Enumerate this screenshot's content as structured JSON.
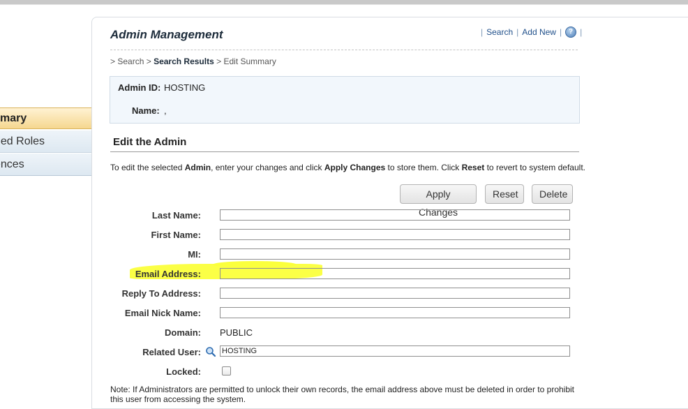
{
  "nav": {
    "items": [
      {
        "label": "mary",
        "active": true
      },
      {
        "label": "ned Roles",
        "active": false
      },
      {
        "label": "ences",
        "active": false
      }
    ]
  },
  "header": {
    "title": "Admin Management",
    "links": {
      "search": "Search",
      "add_new": "Add New",
      "help_glyph": "?"
    }
  },
  "breadcrumb": {
    "prefix": "> ",
    "item1": "Search",
    "sep": " > ",
    "item2": "Search Results",
    "item3": "Edit Summary"
  },
  "summary": {
    "admin_id_label": "Admin ID:",
    "admin_id_value": "HOSTING",
    "name_label": "Name:",
    "name_value": ","
  },
  "section": {
    "title": "Edit the Admin",
    "instr_1": "To edit the selected ",
    "instr_2": "Admin",
    "instr_3": ", enter your changes and click ",
    "instr_4": "Apply Changes",
    "instr_5": " to store them. Click ",
    "instr_6": "Reset",
    "instr_7": " to revert to system default."
  },
  "buttons": {
    "apply": "Apply Changes",
    "reset": "Reset",
    "delete": "Delete"
  },
  "form": {
    "last_name": {
      "label": "Last Name:",
      "value": ""
    },
    "first_name": {
      "label": "First Name:",
      "value": ""
    },
    "mi": {
      "label": "MI:",
      "value": ""
    },
    "email": {
      "label": "Email Address:",
      "value": ""
    },
    "reply_to": {
      "label": "Reply To Address:",
      "value": ""
    },
    "nick": {
      "label": "Email Nick Name:",
      "value": ""
    },
    "domain": {
      "label": "Domain:",
      "value": "PUBLIC"
    },
    "related_user": {
      "label": "Related User:",
      "value": "HOSTING"
    },
    "locked": {
      "label": "Locked:",
      "checked": false
    }
  },
  "note": "Note: If Administrators are permitted to unlock their own records, the email address above must be deleted in order to prohibit this user from accessing the system.",
  "colors": {
    "accent": "#1f4f8a",
    "highlight": "#fbff3c",
    "active_nav": "#f5d790"
  }
}
